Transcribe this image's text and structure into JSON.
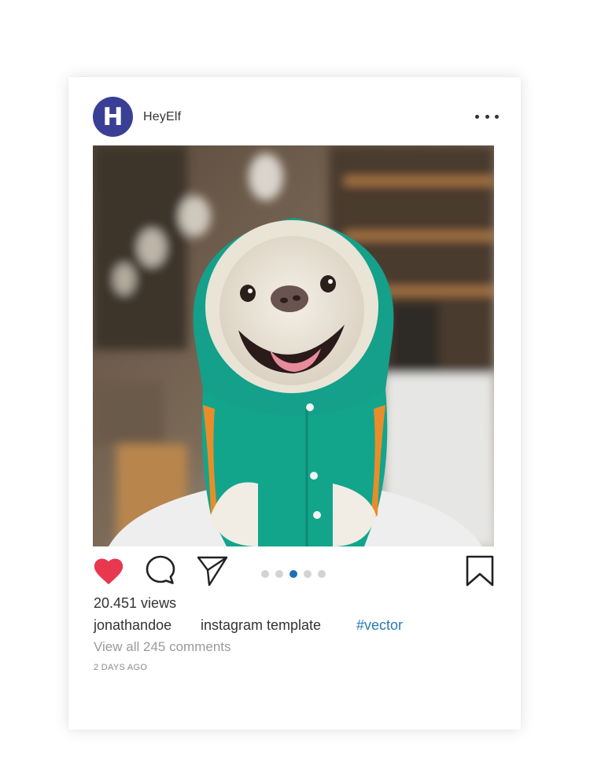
{
  "post": {
    "avatar_letter": "H",
    "username": "HeyElf",
    "more_icon": "more-horizontal-icon",
    "image_alt": "French bulldog wearing a green hoodie",
    "carousel": {
      "count": 5,
      "active_index": 3
    },
    "views": "20.451 views",
    "caption": {
      "user": "jonathandoe",
      "text": "instagram template",
      "hashtag": "#vector"
    },
    "comments_link": "View all 245 comments",
    "timestamp": "2 DAYS AGO"
  },
  "icons": {
    "like": "heart-icon",
    "comment": "comment-bubble-icon",
    "share": "paper-plane-icon",
    "save": "bookmark-icon"
  },
  "colors": {
    "avatar_bg": "#3a3f96",
    "heart": "#e8384f",
    "hashtag": "#2a7ab6",
    "dot_active": "#1f6fb5",
    "dot_inactive": "#d3d3d3"
  }
}
